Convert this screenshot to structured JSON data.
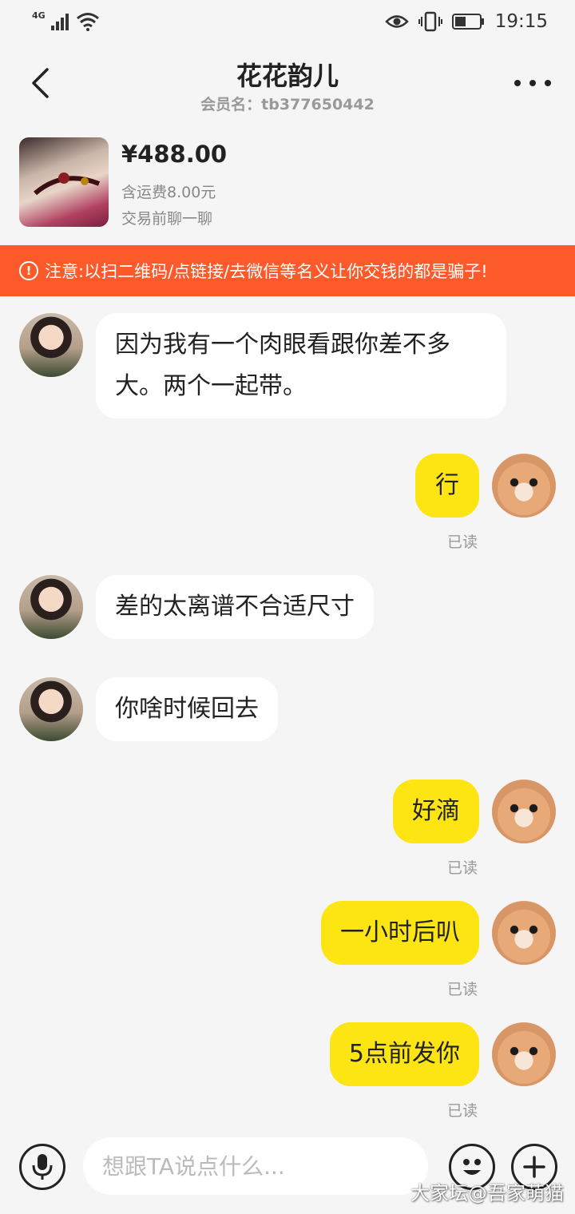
{
  "status_bar": {
    "network": "4G",
    "time": "19:15"
  },
  "header": {
    "title": "花花韵儿",
    "member_label": "会员名：tb377650442"
  },
  "product": {
    "price": "¥488.00",
    "shipping": "含运费8.00元",
    "note": "交易前聊一聊"
  },
  "warning": {
    "text": "注意:以扫二维码/点链接/去微信等名义让你交钱的都是骗子!"
  },
  "messages": [
    {
      "side": "left",
      "text_lines": [
        "因为我有一个肉眼看跟你差不多",
        "大。两个一起带。"
      ]
    },
    {
      "side": "right",
      "text": "行",
      "status": "已读"
    },
    {
      "side": "left",
      "text": "差的太离谱不合适尺寸"
    },
    {
      "side": "left",
      "text": "你啥时候回去"
    },
    {
      "side": "right",
      "text": "好滴",
      "status": "已读"
    },
    {
      "side": "right",
      "text": "一小时后叭",
      "status": "已读"
    },
    {
      "side": "right",
      "text": "5点前发你",
      "status": "已读"
    }
  ],
  "input": {
    "placeholder": "想跟TA说点什么..."
  },
  "watermark": "大家坛@吾家萌猫",
  "colors": {
    "warning_bg": "#fc5a2a",
    "own_bubble": "#fde514",
    "other_bubble": "#ffffff",
    "background": "#f5f5f5"
  },
  "icons": [
    "back-icon",
    "more-icon",
    "alert-icon",
    "microphone-icon",
    "emoji-icon",
    "plus-icon",
    "eye-icon",
    "vibrate-icon",
    "battery-icon",
    "wifi-icon",
    "signal-icon"
  ]
}
